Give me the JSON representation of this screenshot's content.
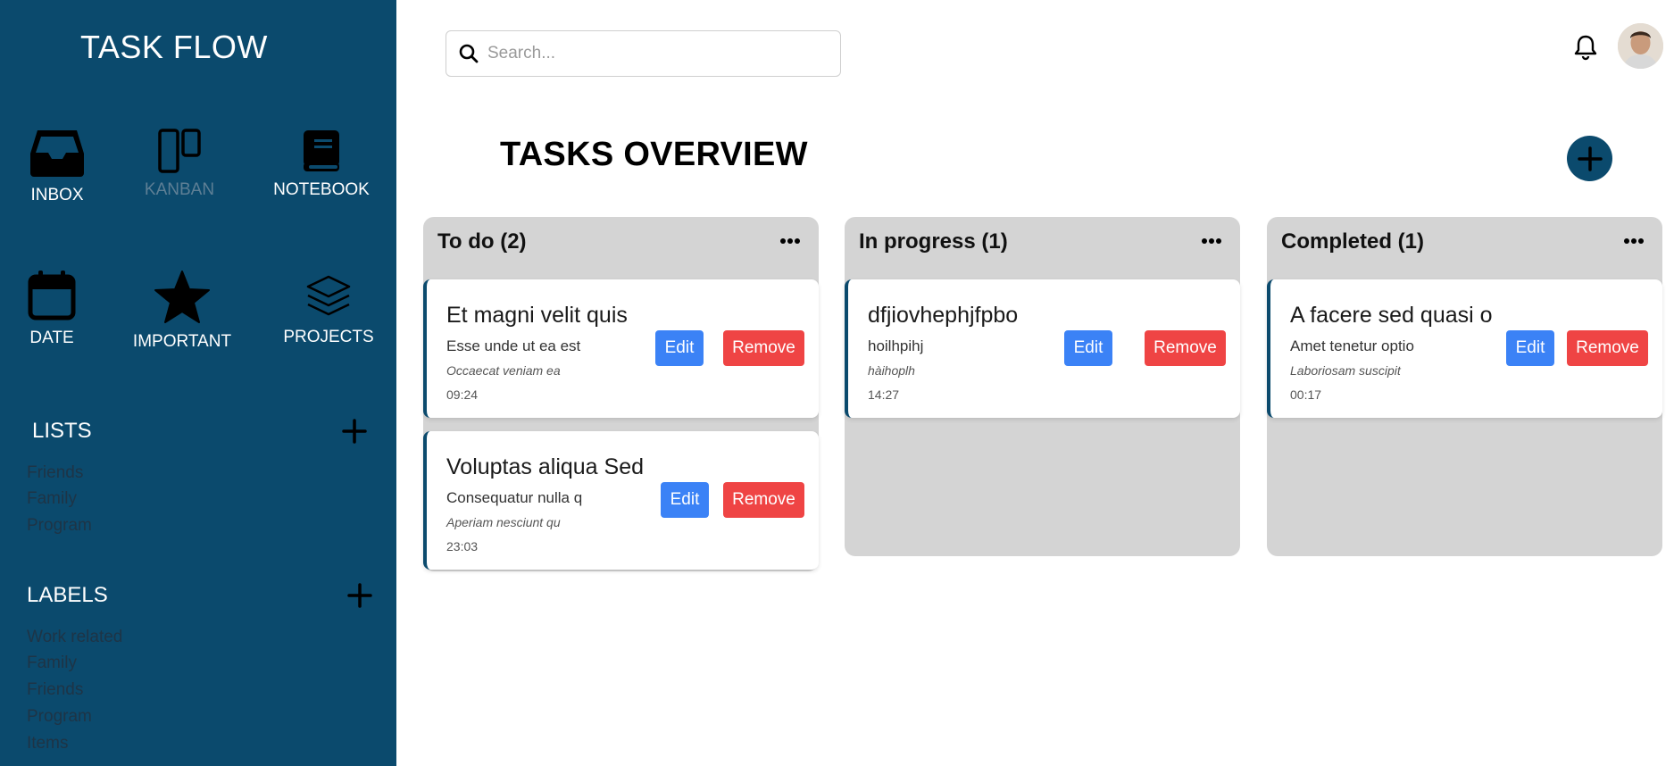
{
  "brand": "TASK FLOW",
  "nav": [
    {
      "label": "INBOX",
      "icon": "inbox-icon",
      "active": true
    },
    {
      "label": "KANBAN",
      "icon": "kanban-icon",
      "active": false
    },
    {
      "label": "NOTEBOOK",
      "icon": "notebook-icon",
      "active": true
    },
    {
      "label": "DATE",
      "icon": "calendar-icon",
      "active": true
    },
    {
      "label": "IMPORTANT",
      "icon": "star-icon",
      "active": true
    },
    {
      "label": "PROJECTS",
      "icon": "layers-icon",
      "active": true
    }
  ],
  "lists": {
    "title": "LISTS",
    "items": [
      "Friends",
      "Family",
      "Program"
    ]
  },
  "labels": {
    "title": "LABELS",
    "items": [
      "Work related",
      "Family",
      "Friends",
      "Program",
      "Items"
    ]
  },
  "search": {
    "placeholder": "Search..."
  },
  "page_title": "TASKS OVERVIEW",
  "colors": {
    "sidebar": "#0b4a6d",
    "edit": "#3b82f6",
    "remove": "#ef4444",
    "column_bg": "#d4d4d4"
  },
  "columns": [
    {
      "title": "To do (2)",
      "cards": [
        {
          "title": "Et magni velit quis",
          "desc": "Esse unde ut ea est",
          "note": "Occaecat veniam ea",
          "time": "09:24",
          "edit": "Edit",
          "remove": "Remove"
        },
        {
          "title": "Voluptas aliqua Sed",
          "desc": "Consequatur nulla q",
          "note": "Aperiam nesciunt qu",
          "time": "23:03",
          "edit": "Edit",
          "remove": "Remove"
        }
      ]
    },
    {
      "title": "In progress (1)",
      "cards": [
        {
          "title": "dfjiovhephjfpbo",
          "desc": "hoilhpihj",
          "note": "hàihoplh",
          "time": "14:27",
          "edit": "Edit",
          "remove": "Remove"
        }
      ]
    },
    {
      "title": "Completed (1)",
      "cards": [
        {
          "title": "A facere sed quasi o",
          "desc": "Amet tenetur optio",
          "note": "Laboriosam suscipit",
          "time": "00:17",
          "edit": "Edit",
          "remove": "Remove"
        }
      ]
    }
  ]
}
